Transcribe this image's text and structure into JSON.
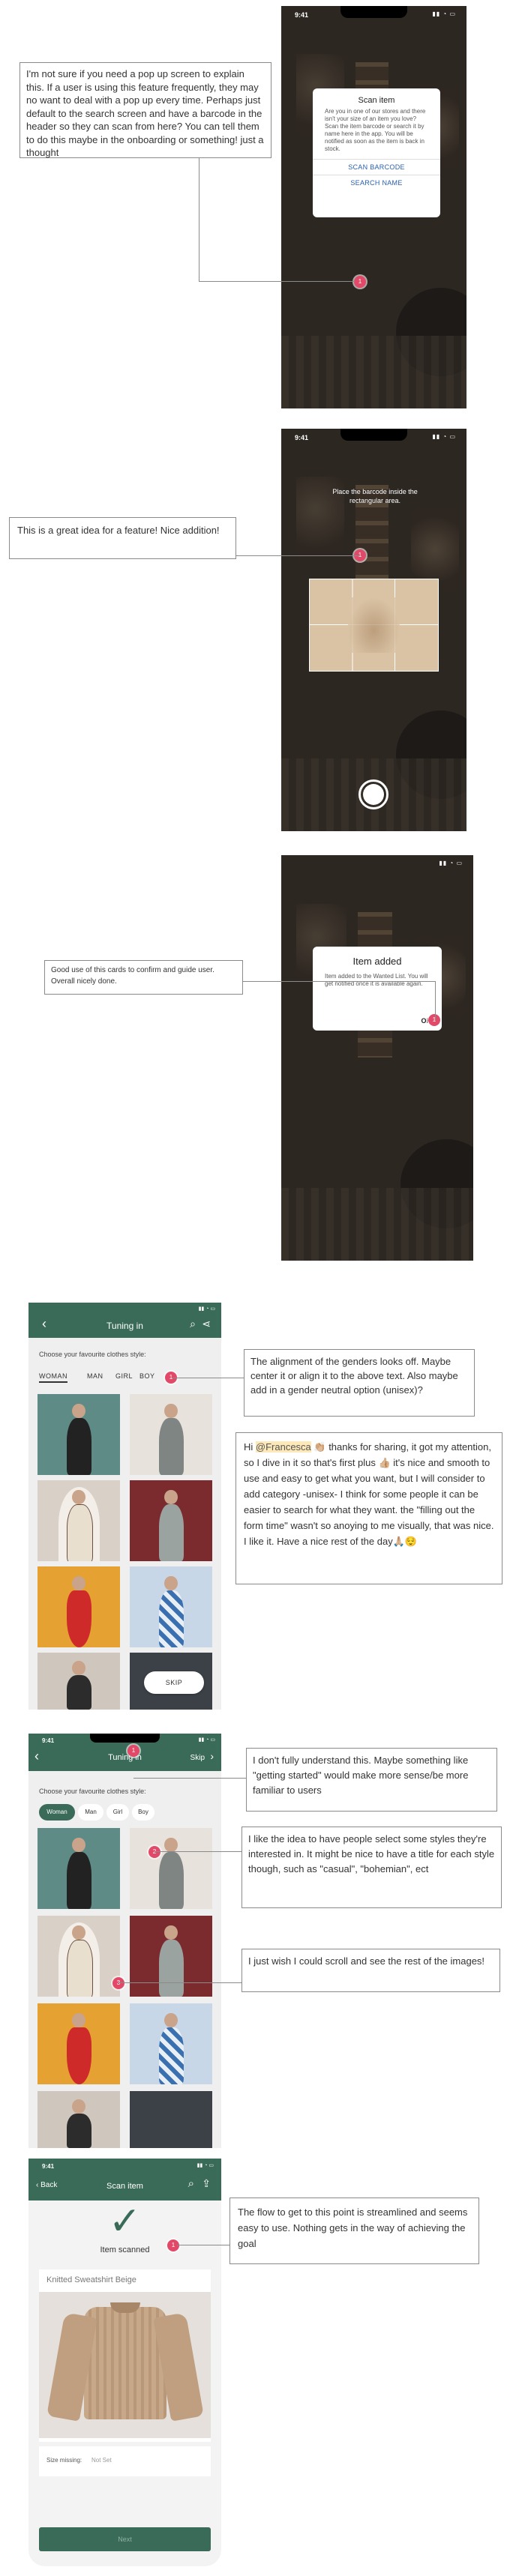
{
  "screen1": {
    "status_time": "9:41",
    "status_icons": "▮▮ ◔ ▭",
    "modal_title": "Scan item",
    "modal_body": "Are you in one of our stores and there isn't your size of an item you love? Scan the item barcode or search it by name here in the app. You will be notified as soon as the item is back in stock.",
    "btn_barcode": "SCAN BARCODE",
    "btn_name": "SEARCH NAME",
    "comment": "I'm not sure if you need a pop up screen to explain this.  If a user is using this feature frequently, they may no want to deal with a pop up every time.  Perhaps just default to the search screen and have a barcode in the header so they can scan from here?  You can tell them to do this maybe in the onboarding or something! just a thought",
    "pin": "1"
  },
  "screen2": {
    "status_time": "9:41",
    "status_icons": "▮▮ ◔ ▭",
    "instruction": "Place the barcode inside the rectangular area.",
    "comment": "This is a great idea for a feature! Nice addition!",
    "pin": "1"
  },
  "screen3": {
    "status_icons": "▮▮ ◔ ▭",
    "modal_title": "Item added",
    "modal_body": "Item added to the Wanted List. You will get notified once it is available again.",
    "ok_label": "OK",
    "comment": "Good use of this cards to confirm and guide user. Overall nicely done.",
    "pin": "1"
  },
  "screen4": {
    "status_icons": "▮▮ ◔ ▭",
    "back_icon": "‹",
    "title": "Tuning in",
    "search_icon": "⌕",
    "share_icon": "⋖",
    "prompt": "Choose your favourite clothes style:",
    "tabs": [
      "WOMAN",
      "MAN",
      "GIRL",
      "BOY"
    ],
    "skip": "SKIP",
    "comment1": "The alignment of the genders looks off. Maybe center it or align it to the above text. Also maybe add in a gender neutral option (unisex)?",
    "comment2_prefix": "Hi ",
    "comment2_mention": "@Francesca",
    "comment2_text": " 👏🏼 thanks for sharing, it got my attention, so I dive in it so that's first plus 👍🏼 it's nice and smooth to use and easy to get what you want, but I will consider to add category -unisex- I think for some people it can be easier to search for what they want. the \"filling out the form time\" wasn't so anoying to me visually, that was nice. I like it. Have a nice rest of the day🙏🏼😌",
    "pin": "1"
  },
  "screen5": {
    "status_time": "9:41",
    "status_icons": "▮▮ ◔ ▭",
    "back_icon": "‹",
    "title": "Tuning in",
    "skip": "Skip",
    "skip_icon": "›",
    "prompt": "Choose your favourite clothes style:",
    "tabs": [
      "Woman",
      "Man",
      "Girl",
      "Boy"
    ],
    "comment1": "I don't fully understand this. Maybe something like \"getting started\" would make more sense/be more familiar to users",
    "comment2": "I like the idea to have people select some styles they're interested in. It might be nice to have a title for each style though, such as \"casual\", \"bohemian\", ect",
    "comment3": "I just wish I could scroll and see the rest of the images!",
    "pins": [
      "1",
      "2",
      "3"
    ]
  },
  "screen6": {
    "status_time": "9:41",
    "status_icons": "▮▮ ◔ ▭",
    "back": "‹ Back",
    "title": "Scan item",
    "search_icon": "⌕",
    "share_icon": "⇪",
    "check_icon": "✓",
    "scanned": "Item scanned",
    "product_name": "Knitted Sweatshirt Beige",
    "size_label": "Size missing:",
    "size_value": "Not Set",
    "button": "Next",
    "comment": "The flow to get to this point is streamlined and seems easy to use. Nothing gets in the way of achieving the goal",
    "pin": "1"
  },
  "colors": {
    "accent": "#3a6b58",
    "pin": "#e24968",
    "link": "#2a5fae"
  }
}
